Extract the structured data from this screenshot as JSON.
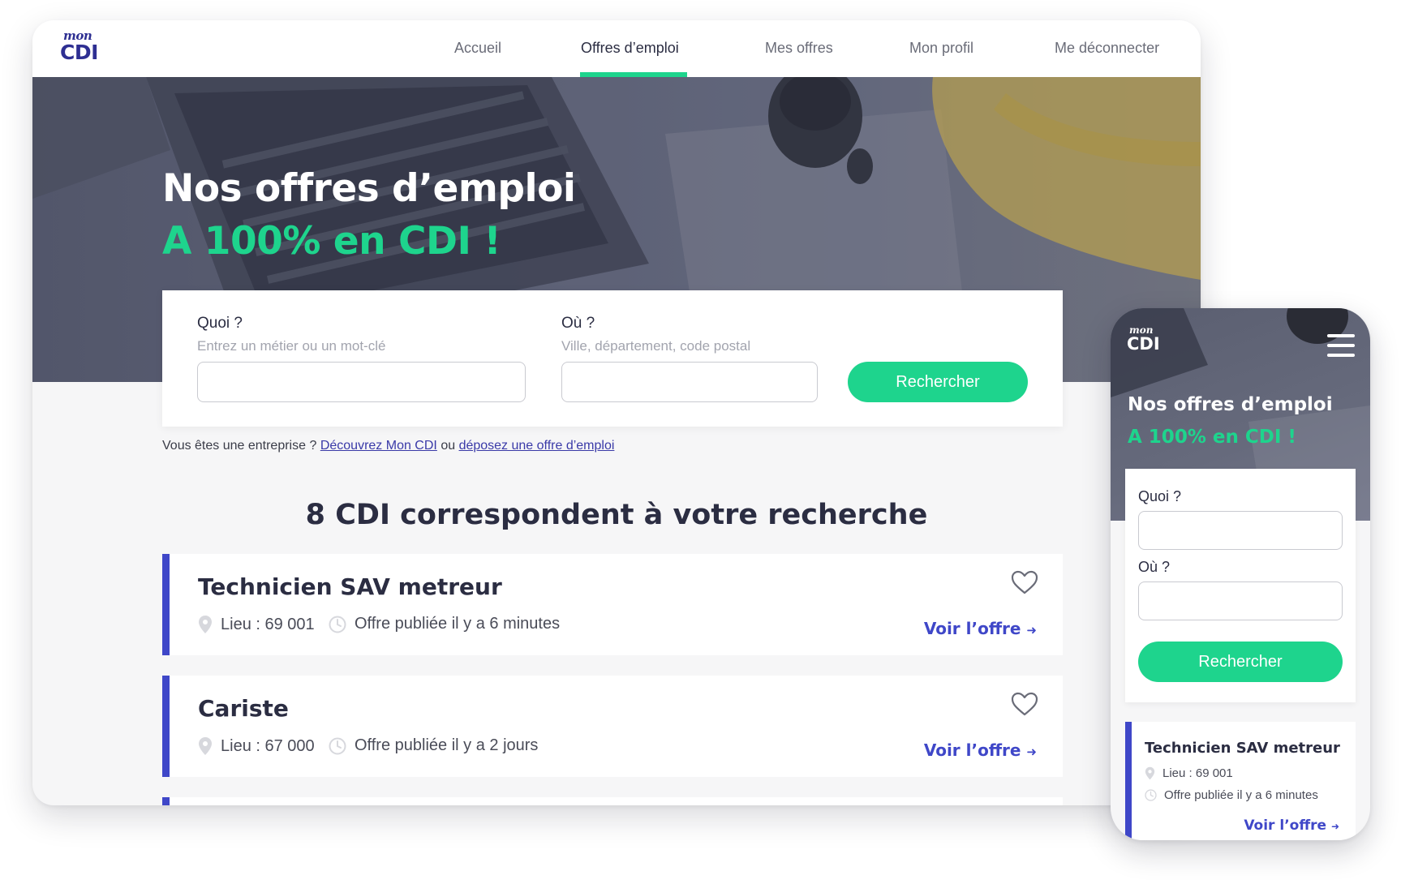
{
  "colors": {
    "brand_navy": "#2e2f92",
    "accent_green": "#1ed48d",
    "accent_blue": "#3f47c8",
    "text_dark": "#2b2d42",
    "page_bg": "#f6f6f7"
  },
  "logo": {
    "top": "mon",
    "bottom": "CDI"
  },
  "nav": {
    "items": [
      {
        "label": "Accueil"
      },
      {
        "label": "Offres d’emploi",
        "active": true
      },
      {
        "label": "Mes offres"
      },
      {
        "label": "Mon profil"
      },
      {
        "label": "Me déconnecter"
      }
    ]
  },
  "hero": {
    "title": "Nos offres d’emploi",
    "subtitle": "A 100% en CDI !"
  },
  "search": {
    "what_label": "Quoi ?",
    "what_placeholder": "Entrez un métier ou un mot-clé",
    "where_label": "Où ?",
    "where_placeholder": "Ville, département, code postal",
    "button": "Rechercher"
  },
  "company": {
    "prefix": "Vous êtes une entreprise ?",
    "link1": "Découvrez  Mon CDI",
    "middle": "ou",
    "link2": "déposez une offre d’emploi"
  },
  "results": {
    "title": "8 CDI correspondent à votre recherche",
    "see_offer": "Voir l’offre",
    "jobs": [
      {
        "title": "Technicien SAV metreur",
        "location": "Lieu : 69 001",
        "posted": "Offre publiée il y a 6 minutes"
      },
      {
        "title": "Cariste",
        "location": "Lieu : 67 000",
        "posted": "Offre publiée il y a 2 jours"
      }
    ]
  },
  "icons": [
    "heart-icon",
    "location-pin-icon",
    "clock-icon",
    "arrow-right-icon",
    "hamburger-menu-icon"
  ],
  "mobile": {
    "title": "Nos offres d’emploi",
    "subtitle": "A 100% en CDI !",
    "what_label": "Quoi ?",
    "where_label": "Où ?",
    "button": "Rechercher",
    "job": {
      "title": "Technicien SAV metreur",
      "location": "Lieu : 69 001",
      "posted": "Offre publiée il y a 6 minutes",
      "see_offer": "Voir l’offre"
    }
  }
}
